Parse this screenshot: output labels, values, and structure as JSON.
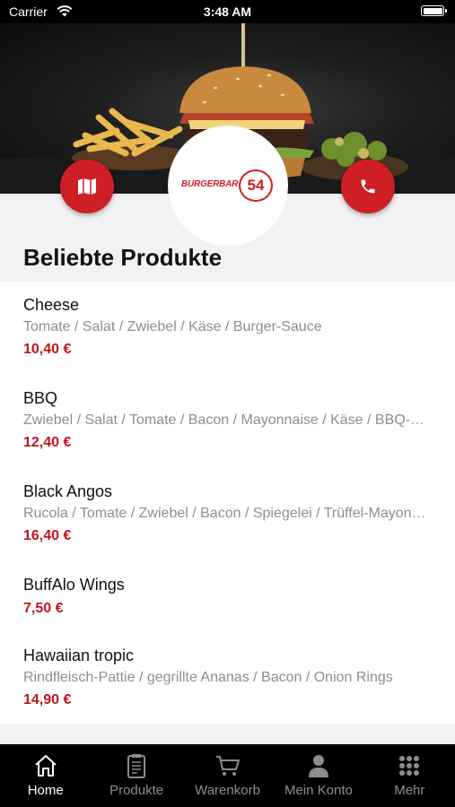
{
  "status_bar": {
    "carrier": "Carrier",
    "time": "3:48 AM"
  },
  "brand": {
    "logo_text": "BURGERBAR",
    "logo_number": "54",
    "accent": "#cf1f26"
  },
  "section_title": "Beliebte Produkte",
  "products": [
    {
      "name": "Cheese",
      "description": "Tomate / Salat / Zwiebel / Käse / Burger-Sauce",
      "price": "10,40 €"
    },
    {
      "name": "BBQ",
      "description": "Zwiebel / Salat / Tomate / Bacon / Mayonnaise / Käse / BBQ-Sauce",
      "price": "12,40 €"
    },
    {
      "name": "Black Angos",
      "description": "Rucola / Tomate / Zwiebel / Bacon / Spiegelei / Trüffel-Mayonnaise",
      "price": "16,40 €"
    },
    {
      "name": "BuffAlo Wings",
      "description": "",
      "price": "7,50 €"
    },
    {
      "name": "Hawaiian tropic",
      "description": "Rindfleisch-Pattie / gegrillte Ananas / Bacon / Onion Rings",
      "price": "14,90 €"
    }
  ],
  "tabs": [
    {
      "label": "Home",
      "icon": "home-icon",
      "active": true
    },
    {
      "label": "Produkte",
      "icon": "menu-icon",
      "active": false
    },
    {
      "label": "Warenkorb",
      "icon": "cart-icon",
      "active": false
    },
    {
      "label": "Mein Konto",
      "icon": "user-icon",
      "active": false
    },
    {
      "label": "Mehr",
      "icon": "grid-icon",
      "active": false
    }
  ]
}
